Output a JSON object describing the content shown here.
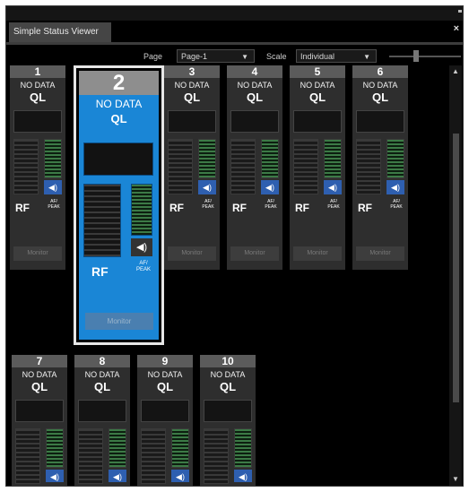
{
  "window": {
    "title": "Simple Status Viewer",
    "close_glyph": "×"
  },
  "toolbar": {
    "page_label": "Page",
    "page_value": "Page-1",
    "scale_label": "Scale",
    "scale_value": "Individual",
    "dropdown_glyph": "▼"
  },
  "channels": {
    "c1": {
      "number": "1",
      "status": "NO DATA",
      "model": "QL",
      "rf": "RF",
      "af_1": "AF/",
      "af_2": "PEAK",
      "monitor": "Monitor"
    },
    "c2": {
      "number": "2",
      "status": "NO DATA",
      "model": "QL",
      "rf": "RF",
      "af_1": "AF/",
      "af_2": "PEAK",
      "monitor": "Monitor"
    },
    "c3": {
      "number": "3",
      "status": "NO DATA",
      "model": "QL",
      "rf": "RF",
      "af_1": "AF/",
      "af_2": "PEAK",
      "monitor": "Monitor"
    },
    "c4": {
      "number": "4",
      "status": "NO DATA",
      "model": "QL",
      "rf": "RF",
      "af_1": "AF/",
      "af_2": "PEAK",
      "monitor": "Monitor"
    },
    "c5": {
      "number": "5",
      "status": "NO DATA",
      "model": "QL",
      "rf": "RF",
      "af_1": "AF/",
      "af_2": "PEAK",
      "monitor": "Monitor"
    },
    "c6": {
      "number": "6",
      "status": "NO DATA",
      "model": "QL",
      "rf": "RF",
      "af_1": "AF/",
      "af_2": "PEAK",
      "monitor": "Monitor"
    },
    "c7": {
      "number": "7",
      "status": "NO DATA",
      "model": "QL"
    },
    "c8": {
      "number": "8",
      "status": "NO DATA",
      "model": "QL"
    },
    "c9": {
      "number": "9",
      "status": "NO DATA",
      "model": "QL"
    },
    "c10": {
      "number": "10",
      "status": "NO DATA",
      "model": "QL"
    }
  },
  "speaker_glyph": "◀)",
  "scroll_up_glyph": "▲",
  "scroll_down_glyph": "▼",
  "colors": {
    "selected": "#1a86d6",
    "panel": "#2e2e2e",
    "meter_green": "#3c7a46",
    "speaker_blue": "#2e5fb0"
  }
}
